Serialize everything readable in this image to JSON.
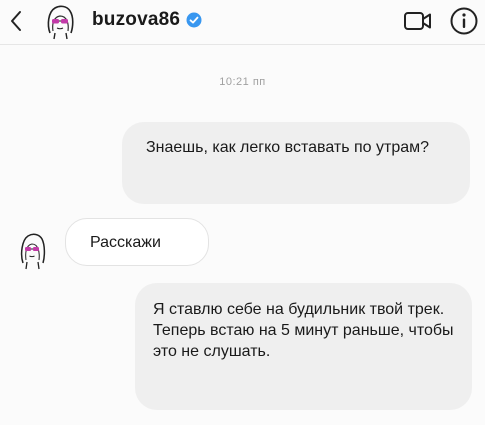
{
  "header": {
    "username": "buzova86",
    "verified": true,
    "back_icon": "chevron-left-icon",
    "video_icon": "video-camera-icon",
    "info_icon": "info-icon",
    "verified_color": "#3897f0"
  },
  "conversation": {
    "timestamp": "10:21 пп",
    "messages": [
      {
        "direction": "outgoing",
        "text": "Знаешь, как легко вставать по утрам?"
      },
      {
        "direction": "incoming",
        "text": "Расскажи"
      },
      {
        "direction": "outgoing",
        "text": "Я ставлю себе на будильник твой трек. Теперь встаю на 5 минут раньше, чтобы это не слушать."
      }
    ]
  }
}
